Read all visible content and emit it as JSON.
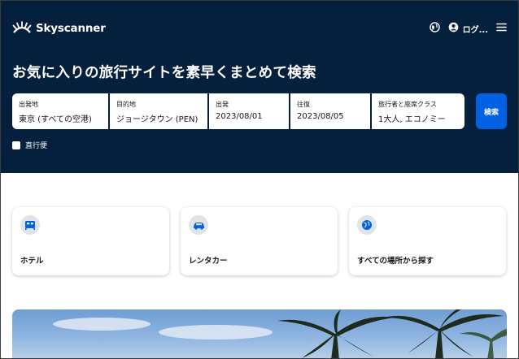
{
  "header": {
    "brand": "Skyscanner",
    "login_label": "ログ..."
  },
  "hero": {
    "headline": "お気に入りの旅行サイトを素早くまとめて検索"
  },
  "search": {
    "origin_label": "出発地",
    "origin_value": "東京 (すべての空港)",
    "destination_label": "目的地",
    "destination_value": "ジョージタウン (PEN)",
    "depart_label": "出発",
    "depart_value": "2023/08/01",
    "return_label": "往復",
    "return_value": "2023/08/05",
    "travellers_label": "旅行者と座席クラス",
    "travellers_value": "1大人, エコノミー",
    "search_button": "検索",
    "direct_label": "直行便"
  },
  "cards": [
    {
      "label": "ホテル",
      "icon": "bed-icon"
    },
    {
      "label": "レンタカー",
      "icon": "car-icon"
    },
    {
      "label": "すべての場所から探す",
      "icon": "globe-icon"
    }
  ],
  "colors": {
    "hero_bg": "#05203c",
    "accent": "#0062e3",
    "icon_blue": "#0062e3"
  }
}
